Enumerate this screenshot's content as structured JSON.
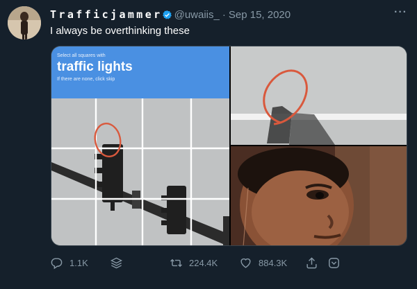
{
  "tweet": {
    "display_name": "Trafficjammer",
    "handle": "@uwaiis_",
    "separator": "·",
    "date": "Sep 15, 2020",
    "more": "···",
    "text": "I always be overthinking these"
  },
  "captcha": {
    "instruction": "Select all squares with",
    "target": "traffic lights",
    "skip_hint": "If there are none, click skip"
  },
  "actions": {
    "reply_count": "1.1K",
    "retweet_count": "224.4K",
    "like_count": "884.3K"
  },
  "colors": {
    "background": "#15202b",
    "muted": "#8899a6",
    "verified": "#1da1f2",
    "captcha_blue": "#4a90e2",
    "red_circle": "#d9593d"
  },
  "icons": [
    "verified-badge-icon",
    "more-icon",
    "reply-icon",
    "stack-icon",
    "retweet-icon",
    "like-icon",
    "share-icon",
    "bookmark-icon"
  ]
}
